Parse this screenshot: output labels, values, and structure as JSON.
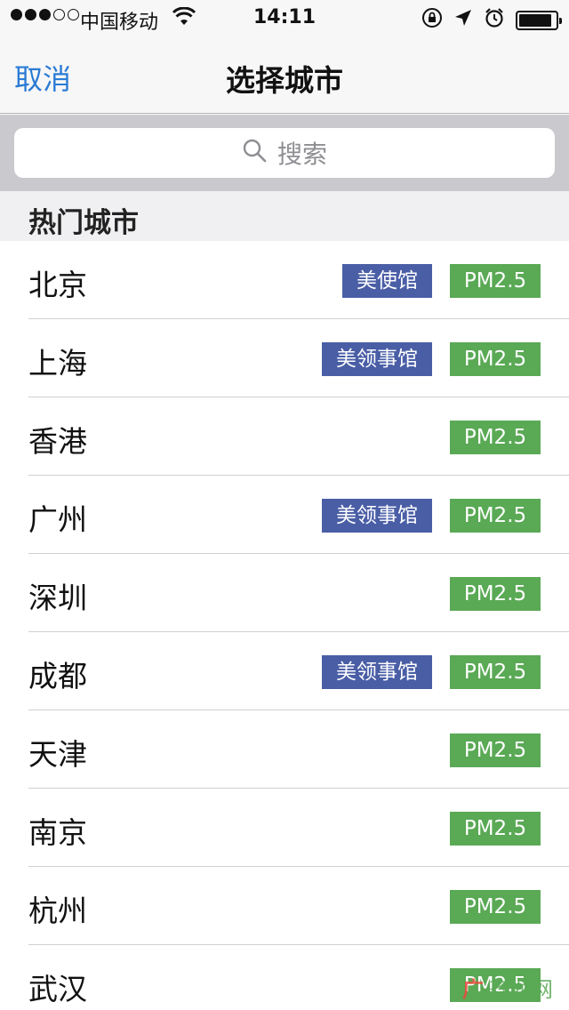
{
  "status": {
    "carrier": "中国移动",
    "time": "14:11",
    "signal_bars_on": 3,
    "signal_bars_total": 5,
    "battery_level": 0.9
  },
  "nav": {
    "cancel_label": "取消",
    "title": "选择城市"
  },
  "search": {
    "placeholder": "搜索"
  },
  "section": {
    "title": "热门城市"
  },
  "cities": [
    {
      "name": "北京",
      "embassy": "美使馆",
      "pm": "PM2.5"
    },
    {
      "name": "上海",
      "embassy": "美领事馆",
      "pm": "PM2.5"
    },
    {
      "name": "香港",
      "embassy": "",
      "pm": "PM2.5"
    },
    {
      "name": "广州",
      "embassy": "美领事馆",
      "pm": "PM2.5"
    },
    {
      "name": "深圳",
      "embassy": "",
      "pm": "PM2.5"
    },
    {
      "name": "成都",
      "embassy": "美领事馆",
      "pm": "PM2.5"
    },
    {
      "name": "天津",
      "embassy": "",
      "pm": "PM2.5"
    },
    {
      "name": "南京",
      "embassy": "",
      "pm": "PM2.5"
    },
    {
      "name": "杭州",
      "embassy": "",
      "pm": "PM2.5"
    },
    {
      "name": "武汉",
      "embassy": "",
      "pm": "PM2.5"
    }
  ],
  "watermark": {
    "text_red": "广",
    "text_green": "齐龙网"
  },
  "colors": {
    "accent_blue": "#2b7bd4",
    "embassy_badge": "#4a5ea6",
    "pm_badge": "#5aa955"
  }
}
